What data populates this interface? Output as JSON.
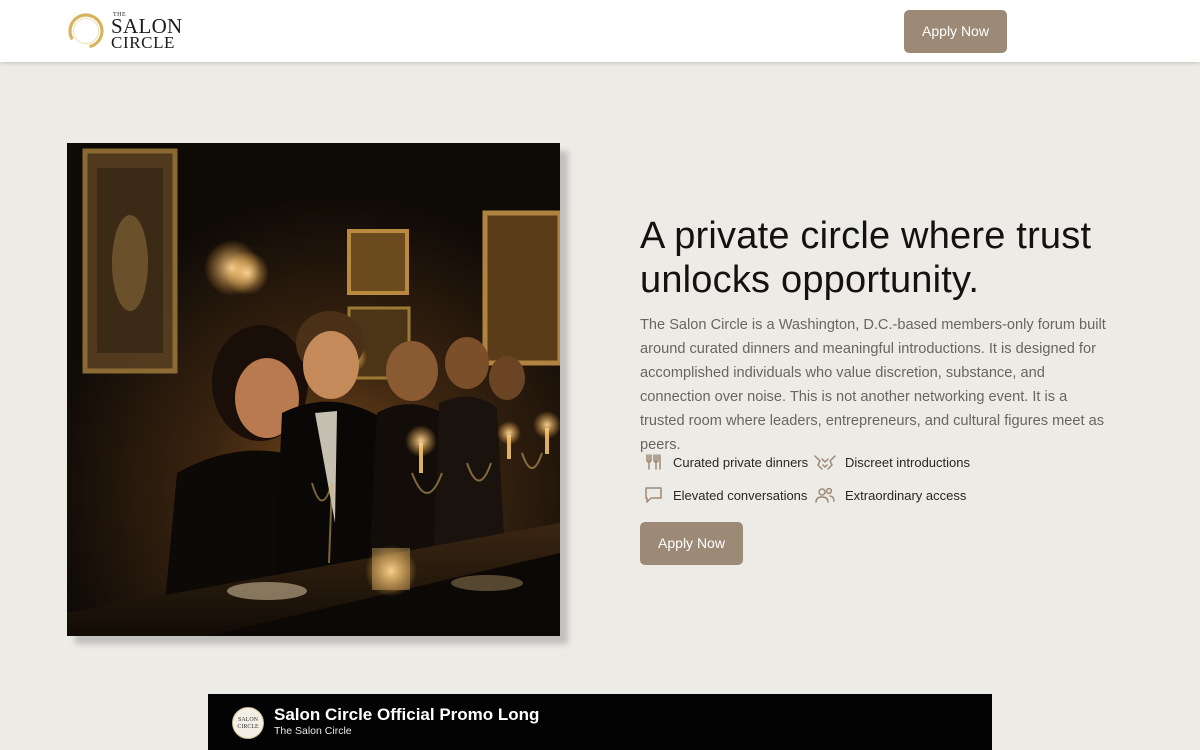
{
  "brand": {
    "logo_the": "THE",
    "logo_salon": "SALON",
    "logo_circle": "CIRCLE",
    "accent": "#9d8a76",
    "gold": "#d7b35b"
  },
  "header": {
    "apply_label": "Apply Now"
  },
  "hero": {
    "image_icon": "dinner-photo",
    "title": "A private circle where trust unlocks opportunity.",
    "description": "The Salon Circle is a Washington, D.C.-based members-only forum built around curated dinners and meaningful introductions. It is designed for accomplished individuals who value discretion, substance, and connection over noise. This is not another networking event. It is a trusted room where leaders, entrepreneurs, and cultural figures meet as peers.",
    "features": [
      {
        "icon": "utensils-icon",
        "label": "Curated private dinners"
      },
      {
        "icon": "handshake-icon",
        "label": "Discreet introductions"
      },
      {
        "icon": "chat-bubble-icon",
        "label": "Elevated conversations"
      },
      {
        "icon": "people-icon",
        "label": "Extraordinary access"
      }
    ],
    "apply_label": "Apply Now"
  },
  "video": {
    "title": "Salon Circle Official Promo Long",
    "channel": "The Salon Circle",
    "avatar_text": "SALON CIRCLE"
  }
}
